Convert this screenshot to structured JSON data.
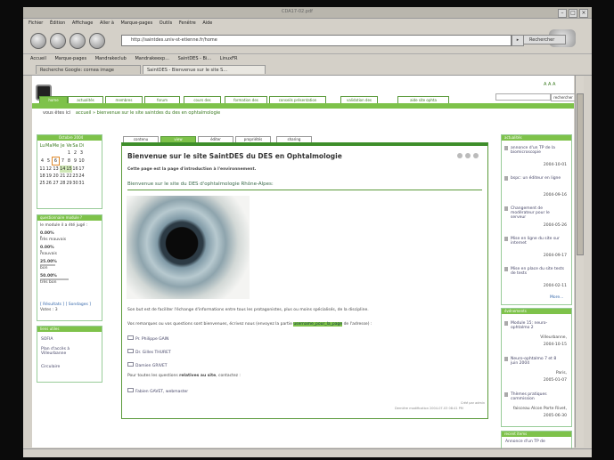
{
  "window": {
    "title": "CDA17-02.pdf"
  },
  "menu": [
    "Fichier",
    "Édition",
    "Affichage",
    "Aller à",
    "Marque-pages",
    "Outils",
    "Fenêtre",
    "Aide"
  ],
  "nav": {
    "url": "http://saintdes.univ-st-etienne.fr/home",
    "search_label": "Rechercher"
  },
  "bookmarks": [
    "Accueil",
    "Marque-pages",
    "Mandrakeclub",
    "Mandrakeexp...",
    "SaintDES - Bi...",
    "LinuxFR"
  ],
  "tabs": [
    "Recherche Google: cornea image",
    "SaintDES - Bienvenue sur le site S..."
  ],
  "site": {
    "top_links": "A A A",
    "search_button": "rechercher",
    "main_nav": [
      "home",
      "actualités",
      "membres",
      "forum",
      "cours des",
      "formation des",
      "conseils présentation",
      "validation des",
      "aide site ophta"
    ],
    "breadcrumb_prefix": "vous êtes ici",
    "breadcrumb": "accueil » bienvenue sur le site saintdes du des en ophtalmologie",
    "content_tabs": [
      "contenu",
      "view",
      "éditer",
      "propriétés",
      "sharing"
    ],
    "title": "Bienvenue sur le site SaintDES du DES en Ophtalmologie",
    "intro": "Cette page est la page d'introduction à l'environnement.",
    "subtitle": "Bienvenue sur le site du DES d'ophtalmologie Rhône-Alpes:",
    "para1": "Son but est de faciliter l'échange d'informations entre tous les protagonistes, plus ou moins spécialisés, de la discipline.",
    "para2": "Vos remarques ou vos questions sont bienvenues, écrivez nous (envoyez la partie",
    "para2_link": "username_pour_la_page",
    "para2_end": "de l'adresse) :",
    "contacts": [
      "Pr. Philippe GAIN",
      "Dr. Gilles THURET",
      "Damien GRIVET"
    ],
    "all_questions": "Pour toutes les questions",
    "all_questions_bold": "relatives au site",
    "all_questions_end": ", contactez :",
    "webmaster": "Fabien GAVET, webmaster",
    "footer_author": "Créé par admin",
    "footer_modified": "Dernière modification 2004-07-03 08:41 PM",
    "calendar": {
      "month": "Octobre 2004",
      "days": [
        "Lu",
        "Ma",
        "Me",
        "Je",
        "Ve",
        "Sa",
        "Di"
      ],
      "weeks": [
        [
          "",
          "",
          "",
          "",
          "1",
          "2",
          "3"
        ],
        [
          "4",
          "5",
          "6",
          "7",
          "8",
          "9",
          "10"
        ],
        [
          "11",
          "12",
          "13",
          "14",
          "15",
          "16",
          "17"
        ],
        [
          "18",
          "19",
          "20",
          "21",
          "22",
          "23",
          "24"
        ],
        [
          "25",
          "26",
          "27",
          "28",
          "29",
          "30",
          "31"
        ]
      ]
    },
    "poll": {
      "title": "questionnaire module ?",
      "question": "le module il a été jugé :",
      "results": [
        {
          "pct": "0.00%",
          "label": "très mauvais"
        },
        {
          "pct": "0.00%",
          "label": "mauvais"
        },
        {
          "pct": "25.00%",
          "label": "bon"
        },
        {
          "pct": "50.00%",
          "label": "très bon"
        }
      ],
      "links": "[ Résultats ] [ Sondages ]",
      "votes": "Votes : 3"
    },
    "liens": {
      "title": "liens utiles",
      "items": [
        "SOFIA",
        "Plan d'accès à Villeurbanne",
        "Circulaire"
      ]
    },
    "actualites": {
      "title": "actualités",
      "items": [
        {
          "text": "annonce d'un TP de la biomicroscopie",
          "date": "2004-10-01"
        },
        {
          "text": "bspc: un éditeur en ligne",
          "date": "2004-09-16"
        },
        {
          "text": "Changement de modèrateur pour le serveur",
          "date": "2004-05-26"
        },
        {
          "text": "Mise en ligne du site sur internet",
          "date": "2004-09-17"
        },
        {
          "text": "Mise en place du site tests de tests",
          "date": "2004-02-11"
        }
      ],
      "more": "More..."
    },
    "evenements": {
      "title": "événements",
      "items": [
        {
          "text": "Module 15: neuro-ophtalmo 2",
          "place": "Villeurbanne,",
          "date": "2004-10-15"
        },
        {
          "text": "Neuro-ophtalmo 7 et 8 juin 2004",
          "place": "Paris,",
          "date": "2005-01-07"
        },
        {
          "text": "Thèmes pratiques commission",
          "place": "faisceau Alcon Porte Rivet,",
          "date": "2005-06-30"
        }
      ]
    },
    "recent": {
      "title": "recent items",
      "item": "Annonce d'un TP de"
    }
  }
}
